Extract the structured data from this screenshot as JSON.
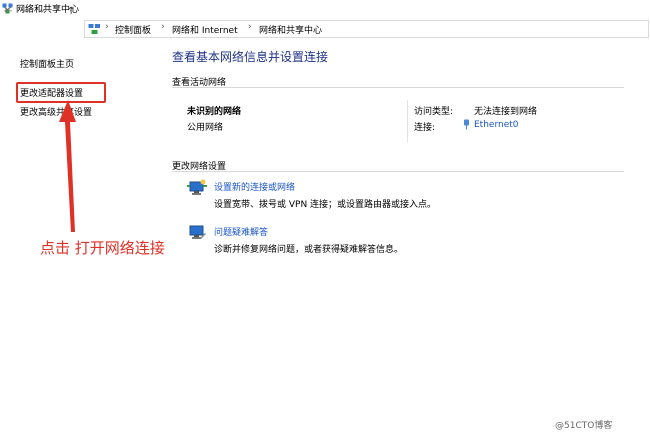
{
  "window": {
    "title": "网络和共享中心"
  },
  "nav": {
    "back": "←",
    "forward": "→",
    "recent": "⌄",
    "up": "↑"
  },
  "breadcrumb": {
    "sep": "›",
    "items": [
      "控制面板",
      "网络和 Internet",
      "网络和共享中心"
    ]
  },
  "sidebar": {
    "items": [
      "控制面板主页",
      "更改适配器设置",
      "更改高级共享设置"
    ]
  },
  "main": {
    "heading": "查看基本网络信息并设置连接",
    "active_section": "查看活动网络",
    "network": {
      "name": "未识别的网络",
      "type": "公用网络",
      "access_label": "访问类型:",
      "access_value": "无法连接到网络",
      "conn_label": "连接:",
      "conn_value": "Ethernet0"
    },
    "change_section": "更改网络设置",
    "tasks": [
      {
        "title": "设置新的连接或网络",
        "desc": "设置宽带、拨号或 VPN 连接；或设置路由器或接入点。",
        "icon": "new-connection-icon"
      },
      {
        "title": "问题疑难解答",
        "desc": "诊断并修复网络问题，或者获得疑难解答信息。",
        "icon": "troubleshoot-icon"
      }
    ]
  },
  "annotation": {
    "text": "点击  打开网络连接",
    "color": "#e03127"
  },
  "watermark": "@51CTO博客"
}
